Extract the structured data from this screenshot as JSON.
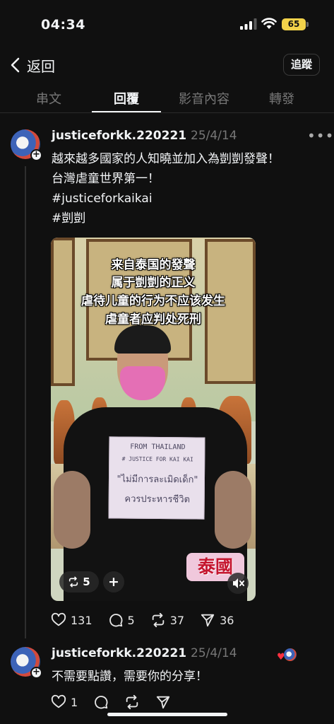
{
  "status_bar": {
    "time": "04:34",
    "battery": "65"
  },
  "header": {
    "back_label": "返回",
    "follow_label": "追蹤"
  },
  "tabs": [
    {
      "label": "串文",
      "active": false
    },
    {
      "label": "回覆",
      "active": true
    },
    {
      "label": "影音內容",
      "active": false
    },
    {
      "label": "轉發",
      "active": false
    }
  ],
  "post": {
    "username": "justiceforkk.220221",
    "date": "25/4/14",
    "lines": [
      "越來越多國家的人知曉並加入為剴剴發聲！",
      "台灣虐童世界第一！",
      "#justiceforkaikai",
      "#剴剴"
    ],
    "video": {
      "overlay_lines": [
        "来自泰国的發聲",
        "属于剴剴的正义",
        "虐待儿童的行为不应该发生",
        "虐童者应判处死刑"
      ],
      "sign_lines": [
        "FROM THAILAND",
        "# JUSTICE FOR KAI KAI",
        "\"ไม่มีการละเมิดเด็ก\"",
        "ควรประหารชีวิต"
      ],
      "country_tag": "泰國",
      "repost_count": "5"
    },
    "stats": {
      "likes": "131",
      "comments": "5",
      "reposts": "37",
      "shares": "36"
    }
  },
  "reply": {
    "username": "justiceforkk.220221",
    "date": "25/4/14",
    "text": "不需要點讚，需要你的分享！",
    "stats": {
      "likes": "1"
    }
  }
}
